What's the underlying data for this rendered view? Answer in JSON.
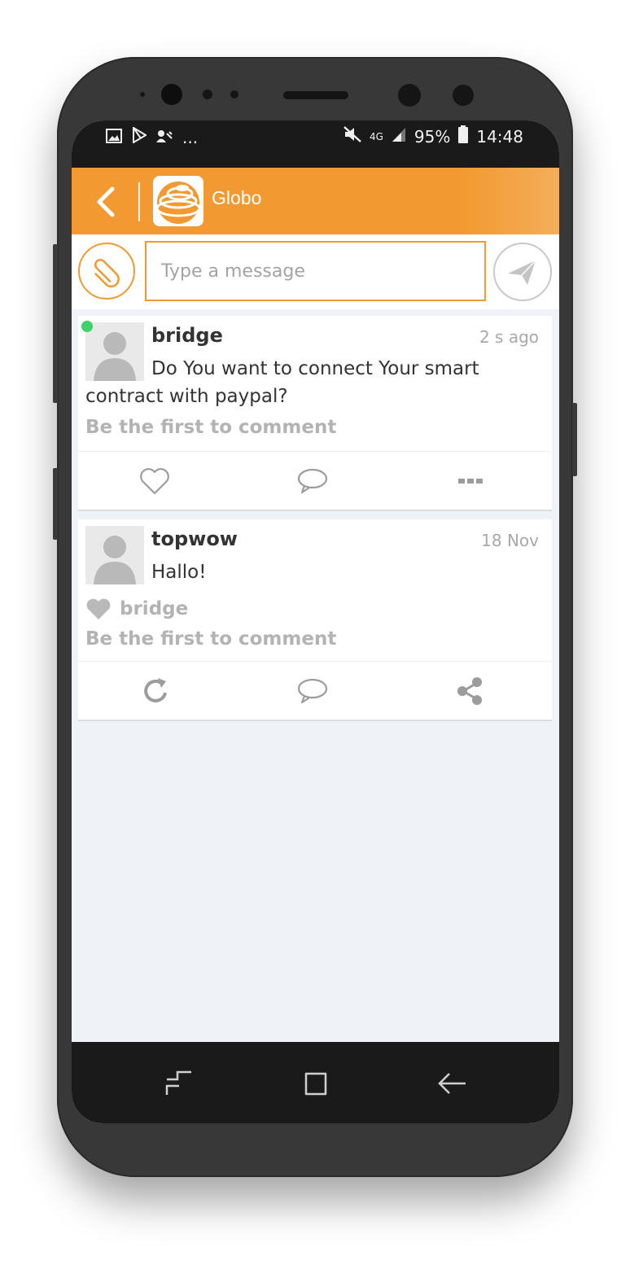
{
  "status_bar": {
    "left_icons": [
      "image-icon",
      "play-store-icon",
      "network-share-icon"
    ],
    "overflow": "...",
    "network": "4G",
    "battery": "95%",
    "time": "14:48"
  },
  "app_bar": {
    "title": "Globo"
  },
  "composer": {
    "placeholder": "Type a message"
  },
  "posts": [
    {
      "author": "bridge",
      "time": "2 s ago",
      "body_line1": "Do You want to connect Your smart",
      "body_line2": "contract with paypal?",
      "comment_prompt": "Be the first to comment",
      "online": true,
      "actions": [
        "heart-icon",
        "comment-icon",
        "more-icon"
      ]
    },
    {
      "author": "topwow",
      "time": "18 Nov",
      "body": "Hallo!",
      "liked_by": "bridge",
      "comment_prompt": "Be the first to comment",
      "actions": [
        "repost-icon",
        "comment-icon",
        "share-icon"
      ]
    }
  ],
  "colors": {
    "accent": "#f29a31",
    "online": "#3fd26b",
    "muted_text": "#b3b3b3"
  }
}
